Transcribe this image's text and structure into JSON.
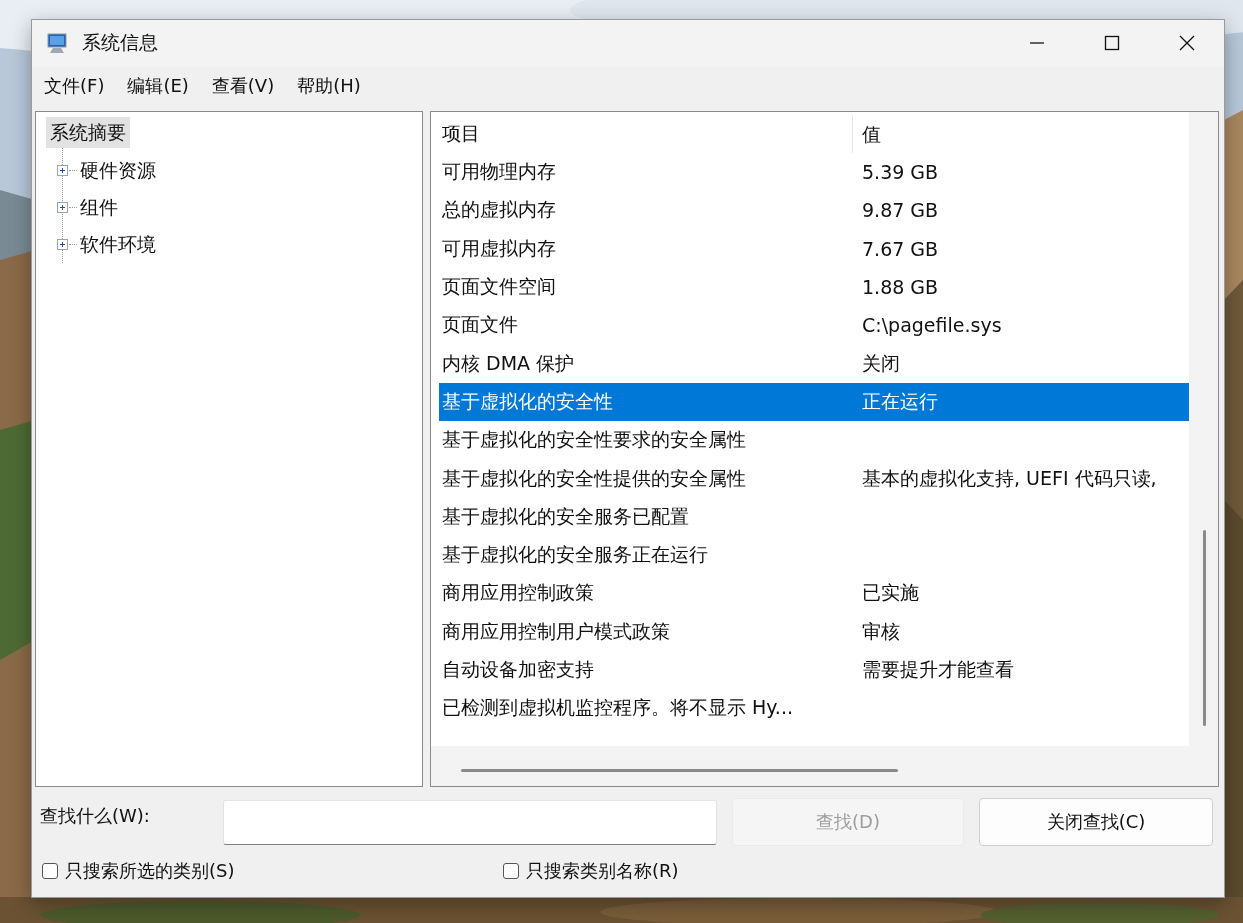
{
  "window": {
    "title": "系统信息"
  },
  "menu": [
    "文件(F)",
    "编辑(E)",
    "查看(V)",
    "帮助(H)"
  ],
  "tree": {
    "items": [
      {
        "label": "系统摘要",
        "selected": true,
        "children": [
          {
            "label": "硬件资源",
            "expanded": false
          },
          {
            "label": "组件",
            "expanded": false
          },
          {
            "label": "软件环境",
            "expanded": false
          }
        ]
      }
    ]
  },
  "table": {
    "columns": [
      "项目",
      "值"
    ],
    "rows": [
      {
        "cells": [
          "可用物理内存",
          "5.39 GB"
        ],
        "selected": false
      },
      {
        "cells": [
          "总的虚拟内存",
          "9.87 GB"
        ],
        "selected": false
      },
      {
        "cells": [
          "可用虚拟内存",
          "7.67 GB"
        ],
        "selected": false
      },
      {
        "cells": [
          "页面文件空间",
          "1.88 GB"
        ],
        "selected": false
      },
      {
        "cells": [
          "页面文件",
          "C:\\pagefile.sys"
        ],
        "selected": false
      },
      {
        "cells": [
          "内核 DMA 保护",
          "关闭"
        ],
        "selected": false
      },
      {
        "cells": [
          "基于虚拟化的安全性",
          "正在运行"
        ],
        "selected": true
      },
      {
        "cells": [
          "基于虚拟化的安全性要求的安全属性"
        ],
        "selected": false
      },
      {
        "cells": [
          "基于虚拟化的安全性提供的安全属性",
          "基本的虚拟化支持, UEFI 代码只读,"
        ],
        "selected": false
      },
      {
        "cells": [
          "基于虚拟化的安全服务已配置"
        ],
        "selected": false
      },
      {
        "cells": [
          "基于虚拟化的安全服务正在运行"
        ],
        "selected": false
      },
      {
        "cells": [
          "商用应用控制政策",
          "已实施"
        ],
        "selected": false
      },
      {
        "cells": [
          "商用应用控制用户模式政策",
          "审核"
        ],
        "selected": false
      },
      {
        "cells": [
          "自动设备加密支持",
          "需要提升才能查看"
        ],
        "selected": false
      },
      {
        "cells": [
          "已检测到虚拟机监控程序。将不显示 Hy..."
        ],
        "selected": false
      }
    ]
  },
  "find": {
    "label": "查找什么(W):",
    "buttons": [
      {
        "label": "查找(D)",
        "disabled": true
      },
      {
        "label": "关闭查找(C)",
        "disabled": false
      }
    ],
    "options": [
      {
        "label": "只搜索所选的类别(S)",
        "checked": false
      },
      {
        "label": "只搜索类别名称(R)",
        "checked": false
      }
    ]
  }
}
